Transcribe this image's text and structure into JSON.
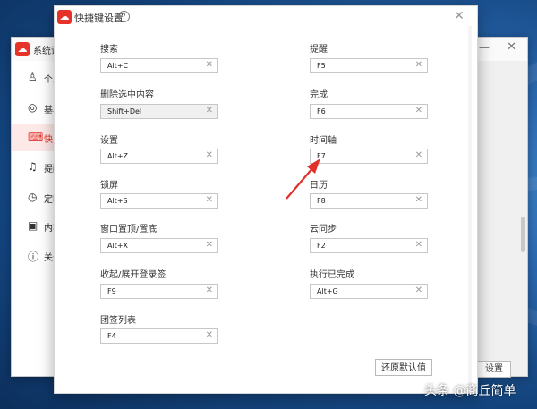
{
  "background_window": {
    "title": "系统设",
    "sidebar": [
      {
        "icon": "user-icon",
        "glyph": "♙",
        "label": "个人"
      },
      {
        "icon": "target-icon",
        "glyph": "◎",
        "label": "基本"
      },
      {
        "icon": "keyboard-icon",
        "glyph": "⌨",
        "label": "快"
      },
      {
        "icon": "bell-icon",
        "glyph": "♫",
        "label": "提醒"
      },
      {
        "icon": "clock-icon",
        "glyph": "◷",
        "label": "定时"
      },
      {
        "icon": "box-icon",
        "glyph": "▣",
        "label": "内容"
      },
      {
        "icon": "info-icon",
        "glyph": "ⓘ",
        "label": "关于"
      }
    ],
    "partial_button": "设置"
  },
  "dialog": {
    "title": "快捷键设置",
    "shortcuts_left": [
      {
        "label": "搜索",
        "value": "Alt+C",
        "disabled": false
      },
      {
        "label": "删除选中内容",
        "value": "Shift+Del",
        "disabled": true
      },
      {
        "label": "设置",
        "value": "Alt+Z",
        "disabled": false
      },
      {
        "label": "锁屏",
        "value": "Alt+S",
        "disabled": false
      },
      {
        "label": "窗口置顶/置底",
        "value": "Alt+X",
        "disabled": false
      },
      {
        "label": "收起/展开登录签",
        "value": "F9",
        "disabled": false
      },
      {
        "label": "团签列表",
        "value": "F4",
        "disabled": false
      }
    ],
    "shortcuts_right": [
      {
        "label": "提醒",
        "value": "F5",
        "disabled": false
      },
      {
        "label": "完成",
        "value": "F6",
        "disabled": false
      },
      {
        "label": "时间轴",
        "value": "F7",
        "disabled": false
      },
      {
        "label": "日历",
        "value": "F8",
        "disabled": false
      },
      {
        "label": "云同步",
        "value": "F2",
        "disabled": false
      },
      {
        "label": "执行已完成",
        "value": "Alt+G",
        "disabled": false
      }
    ],
    "restore_button": "还原默认值"
  },
  "watermark": "头条 @商丘简单",
  "colors": {
    "brand": "#e6332a",
    "arrow": "#e0302a"
  }
}
